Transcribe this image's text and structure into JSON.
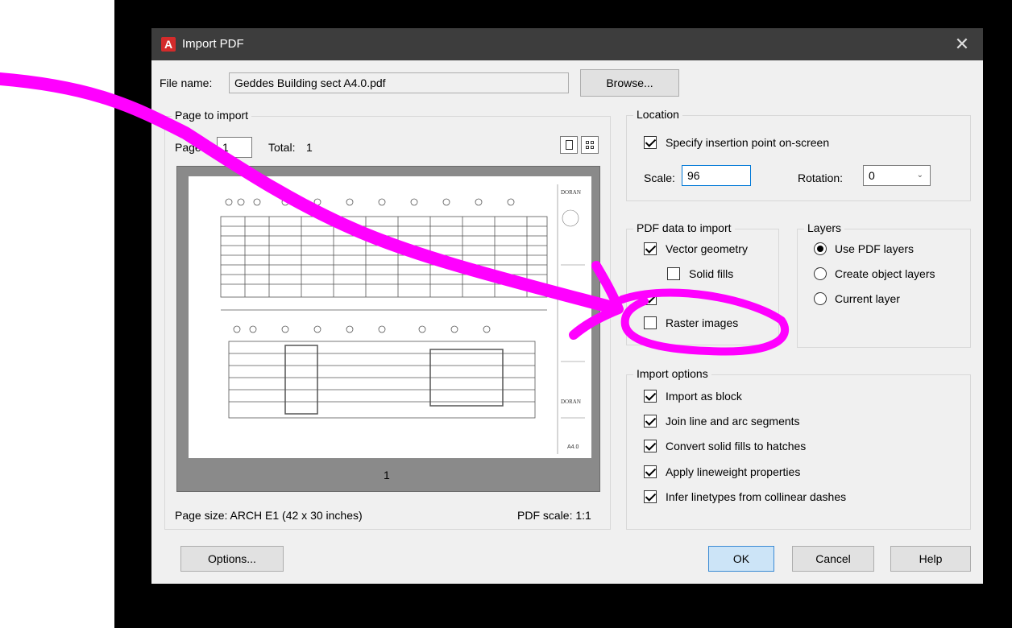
{
  "window": {
    "title": "Import PDF",
    "app_icon_glyph": "A"
  },
  "file": {
    "label": "File name:",
    "value": "Geddes Building sect A4.0.pdf",
    "browse_label": "Browse..."
  },
  "page_to_import": {
    "title": "Page to import",
    "page_label": "Page:",
    "page_value": "1",
    "total_label": "Total:",
    "total_value": "1",
    "preview_page_number": "1",
    "page_size_text": "Page size: ARCH E1 (42 x 30 inches)",
    "pdf_scale_text": "PDF scale: 1:1",
    "sheet_stamp": "A4.0",
    "logo_text": "DORAN"
  },
  "location": {
    "title": "Location",
    "specify_label": "Specify insertion point on-screen",
    "specify_checked": true,
    "scale_label": "Scale:",
    "scale_value": "96",
    "rotation_label": "Rotation:",
    "rotation_value": "0"
  },
  "pdf_data": {
    "title": "PDF data to import",
    "vector_label": "Vector geometry",
    "vector_checked": true,
    "solid_fills_label": "Solid fills",
    "solid_fills_checked": false,
    "truetype_checked": true,
    "raster_label": "Raster images",
    "raster_checked": false
  },
  "layers": {
    "title": "Layers",
    "options": [
      "Use PDF layers",
      "Create object layers",
      "Current layer"
    ],
    "selected": "Use PDF layers"
  },
  "import_options": {
    "title": "Import options",
    "items": [
      {
        "label": "Import as block",
        "checked": true
      },
      {
        "label": "Join line and arc segments",
        "checked": true
      },
      {
        "label": "Convert solid fills to hatches",
        "checked": true
      },
      {
        "label": "Apply lineweight properties",
        "checked": true
      },
      {
        "label": "Infer linetypes from collinear dashes",
        "checked": true
      }
    ]
  },
  "buttons": {
    "options": "Options...",
    "ok": "OK",
    "cancel": "Cancel",
    "help": "Help"
  },
  "colors": {
    "titlebar": "#3d3d3d",
    "dialog": "#f0f0f0",
    "annotation": "#ff00ff",
    "default_button": "#cce4f7"
  }
}
